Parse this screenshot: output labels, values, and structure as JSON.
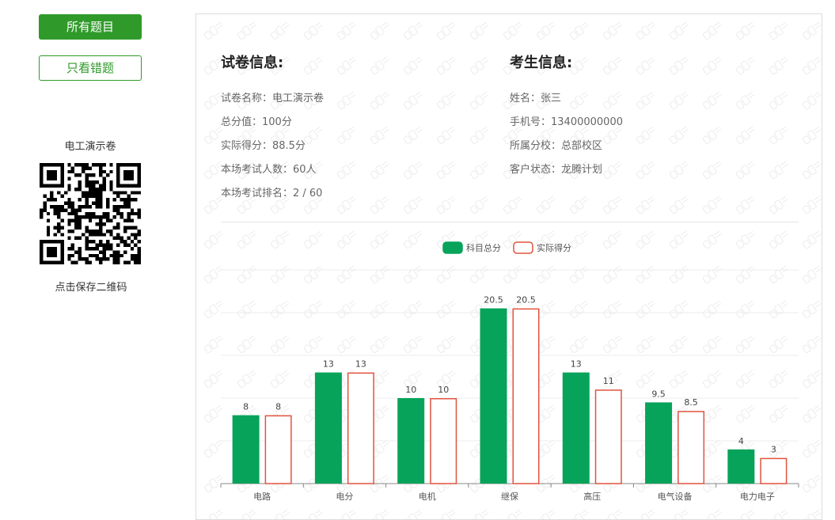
{
  "sidebar": {
    "all_questions_label": "所有题目",
    "wrong_only_label": "只看错题",
    "qr_title": "电工演示卷",
    "qr_caption": "点击保存二维码"
  },
  "exam_info": {
    "title": "试卷信息:",
    "lines": [
      "试卷名称：电工演示卷",
      "总分值：100分",
      "实际得分：88.5分",
      "本场考试人数：60人",
      "本场考试排名：2 / 60"
    ]
  },
  "student_info": {
    "title": "考生信息:",
    "lines": [
      "姓名：张三",
      "手机号：13400000000",
      "所属分校：总部校区",
      "客户状态：龙腾计划"
    ]
  },
  "colors": {
    "primary_green": "#2f9a2a",
    "bar_green": "#07a35a",
    "bar_red_outline": "#e0533f"
  },
  "chart_data": {
    "type": "bar",
    "categories": [
      "电路",
      "电分",
      "电机",
      "继保",
      "高压",
      "电气设备",
      "电力电子"
    ],
    "series": [
      {
        "name": "科目总分",
        "values": [
          8,
          13,
          10,
          20.5,
          13,
          9.5,
          4
        ]
      },
      {
        "name": "实际得分",
        "values": [
          8,
          13,
          10,
          20.5,
          11,
          8.5,
          3
        ]
      }
    ],
    "ylim": [
      0,
      25
    ],
    "grid": true,
    "legend_position": "top-center"
  }
}
